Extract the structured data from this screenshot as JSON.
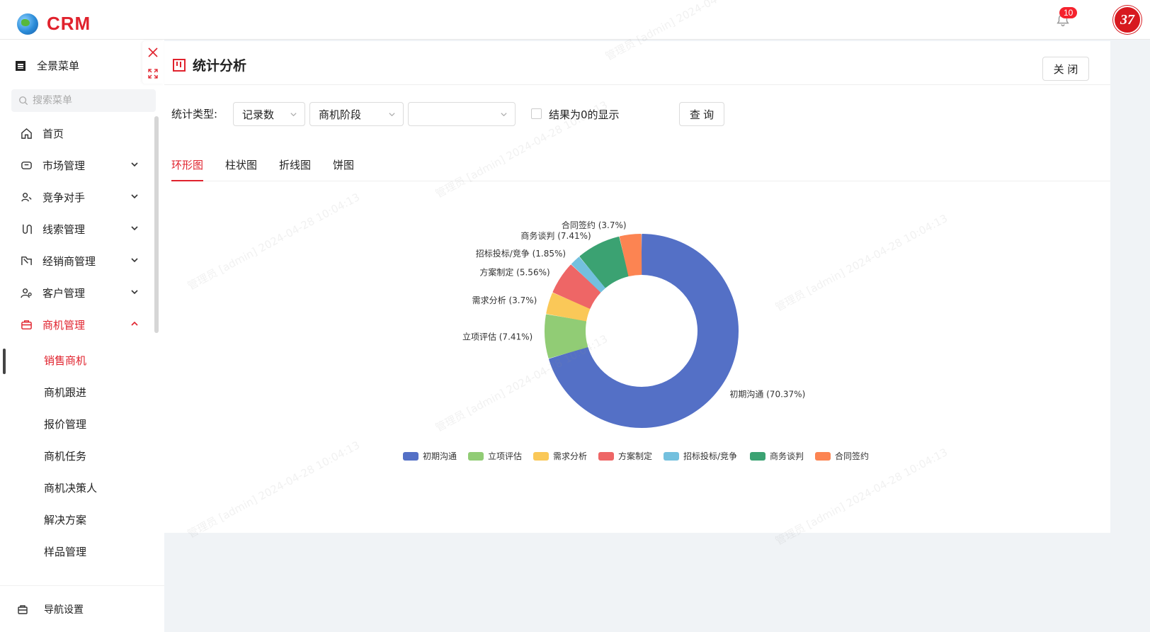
{
  "header": {
    "logo_text": "CRM",
    "notification_count": "10",
    "avatar_text": "37"
  },
  "sidebar": {
    "all_menu_label": "全景菜单",
    "search_placeholder": "搜索菜单",
    "items": [
      {
        "label": "首页",
        "icon": "home-icon",
        "expandable": false
      },
      {
        "label": "市场管理",
        "icon": "market-icon",
        "expandable": true
      },
      {
        "label": "竞争对手",
        "icon": "competitor-icon",
        "expandable": true
      },
      {
        "label": "线索管理",
        "icon": "clue-icon",
        "expandable": true
      },
      {
        "label": "经销商管理",
        "icon": "dealer-icon",
        "expandable": true
      },
      {
        "label": "客户管理",
        "icon": "customer-icon",
        "expandable": true
      },
      {
        "label": "商机管理",
        "icon": "briefcase-icon",
        "expandable": true,
        "expanded": true
      }
    ],
    "sub_items": [
      "销售商机",
      "商机跟进",
      "报价管理",
      "商机任务",
      "商机决策人",
      "解决方案",
      "样品管理"
    ],
    "active_sub": "销售商机",
    "footer_label": "导航设置"
  },
  "panel": {
    "title": "统计分析",
    "close_label": "关 闭",
    "filter_label": "统计类型:",
    "select_1": "记录数",
    "select_2": "商机阶段",
    "select_3": "",
    "checkbox_label": "结果为0的显示",
    "query_label": "查 询",
    "tabs": [
      "环形图",
      "柱状图",
      "折线图",
      "饼图"
    ],
    "active_tab": "环形图"
  },
  "watermark_text": "管理员 [admin] 2024-04-28 10:04:13",
  "colors": {
    "accent": "#e0222d"
  },
  "chart_data": {
    "type": "pie",
    "variant": "doughnut",
    "legend_position": "bottom",
    "series": [
      {
        "name": "初期沟通",
        "value": 70.37,
        "label": "初期沟通 (70.37%)",
        "color": "#5470c6"
      },
      {
        "name": "立项评估",
        "value": 7.41,
        "label": "立项评估 (7.41%)",
        "color": "#91cc75"
      },
      {
        "name": "需求分析",
        "value": 3.7,
        "label": "需求分析 (3.7%)",
        "color": "#fac858"
      },
      {
        "name": "方案制定",
        "value": 5.56,
        "label": "方案制定 (5.56%)",
        "color": "#ee6666"
      },
      {
        "name": "招标投标/竞争",
        "value": 1.85,
        "label": "招标投标/竞争 (1.85%)",
        "color": "#73c0de"
      },
      {
        "name": "商务谈判",
        "value": 7.41,
        "label": "商务谈判 (7.41%)",
        "color": "#3ba272"
      },
      {
        "name": "合同签约",
        "value": 3.7,
        "label": "合同签约 (3.7%)",
        "color": "#fc8452"
      }
    ]
  }
}
